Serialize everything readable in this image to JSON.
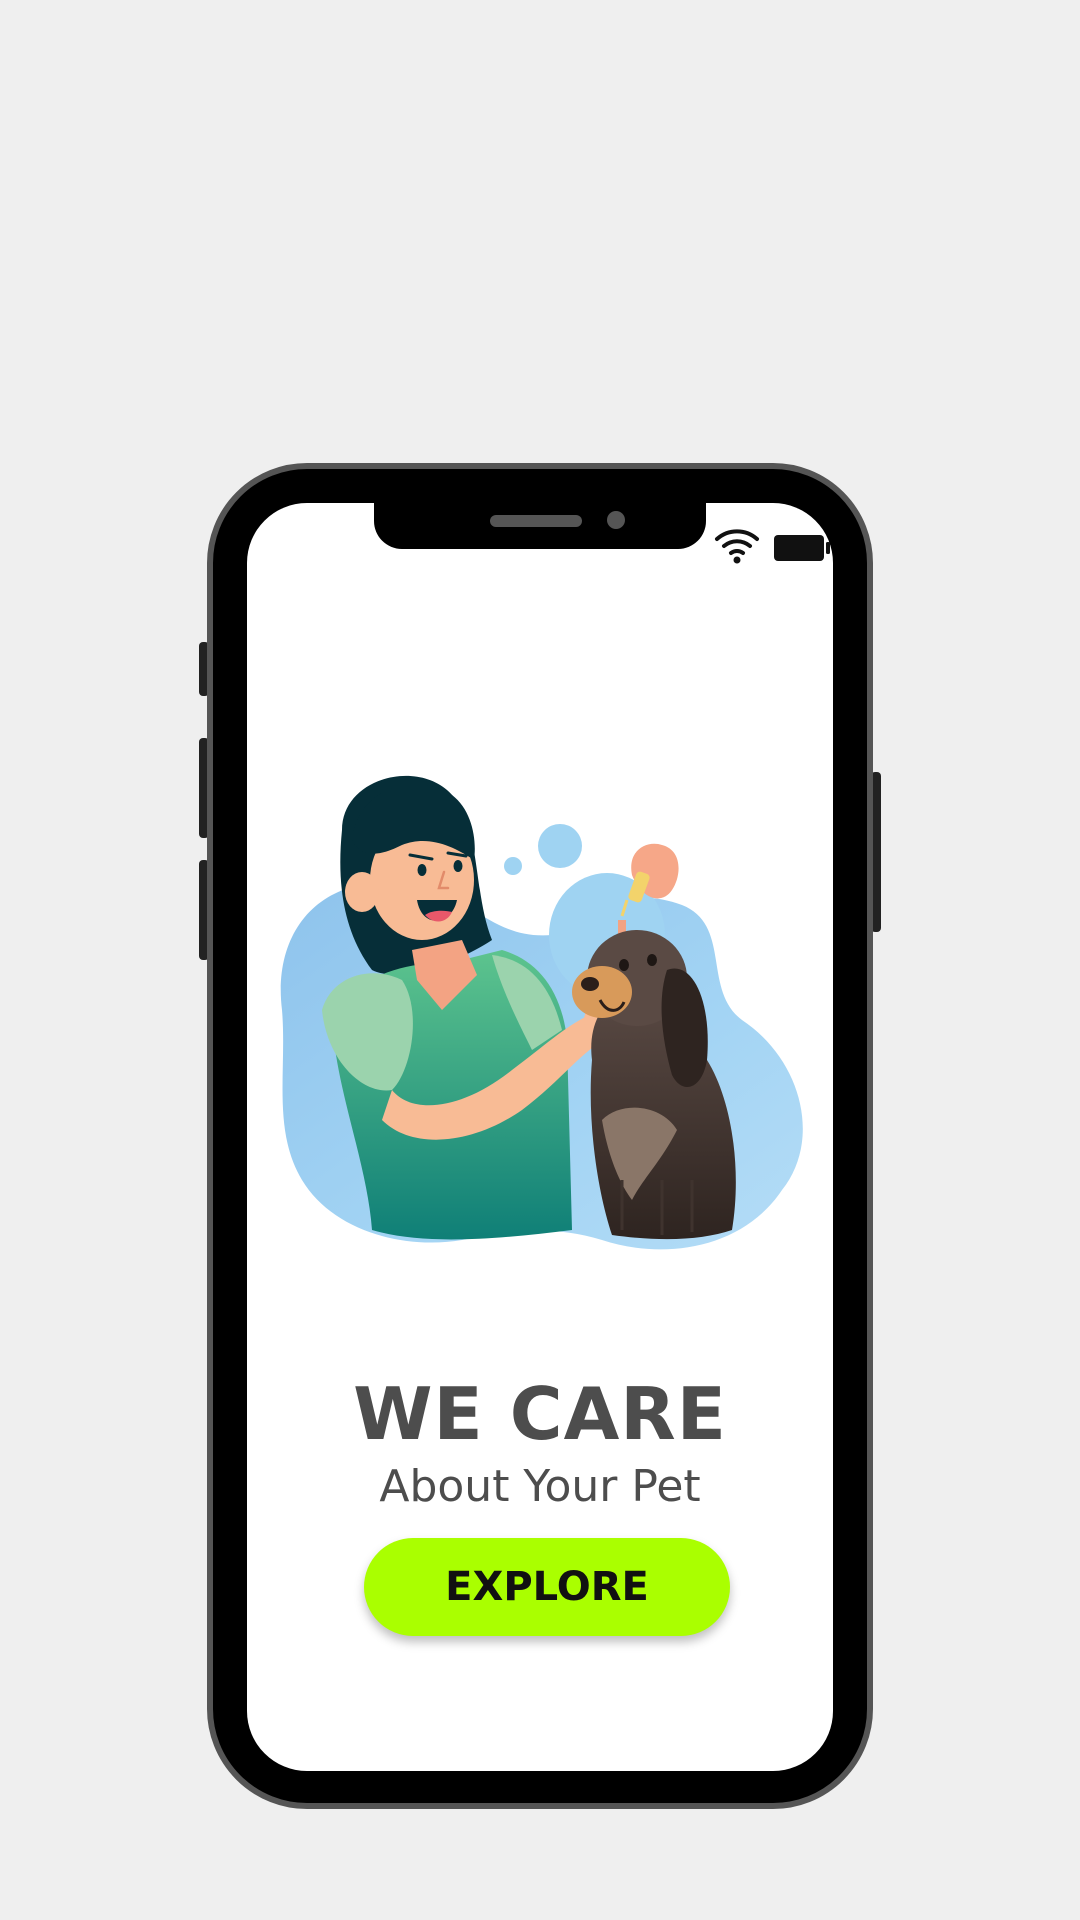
{
  "main": {
    "headline": "WE CARE",
    "subline": "About Your Pet",
    "explore_label": "EXPLORE"
  },
  "status_bar": {
    "icons": [
      "wifi-icon",
      "battery-icon"
    ]
  },
  "colors": {
    "background": "#efefef",
    "screen": "#ffffff",
    "text": "#4d4d4d",
    "button": "#aaff00",
    "blob": "#9fd3f2"
  }
}
